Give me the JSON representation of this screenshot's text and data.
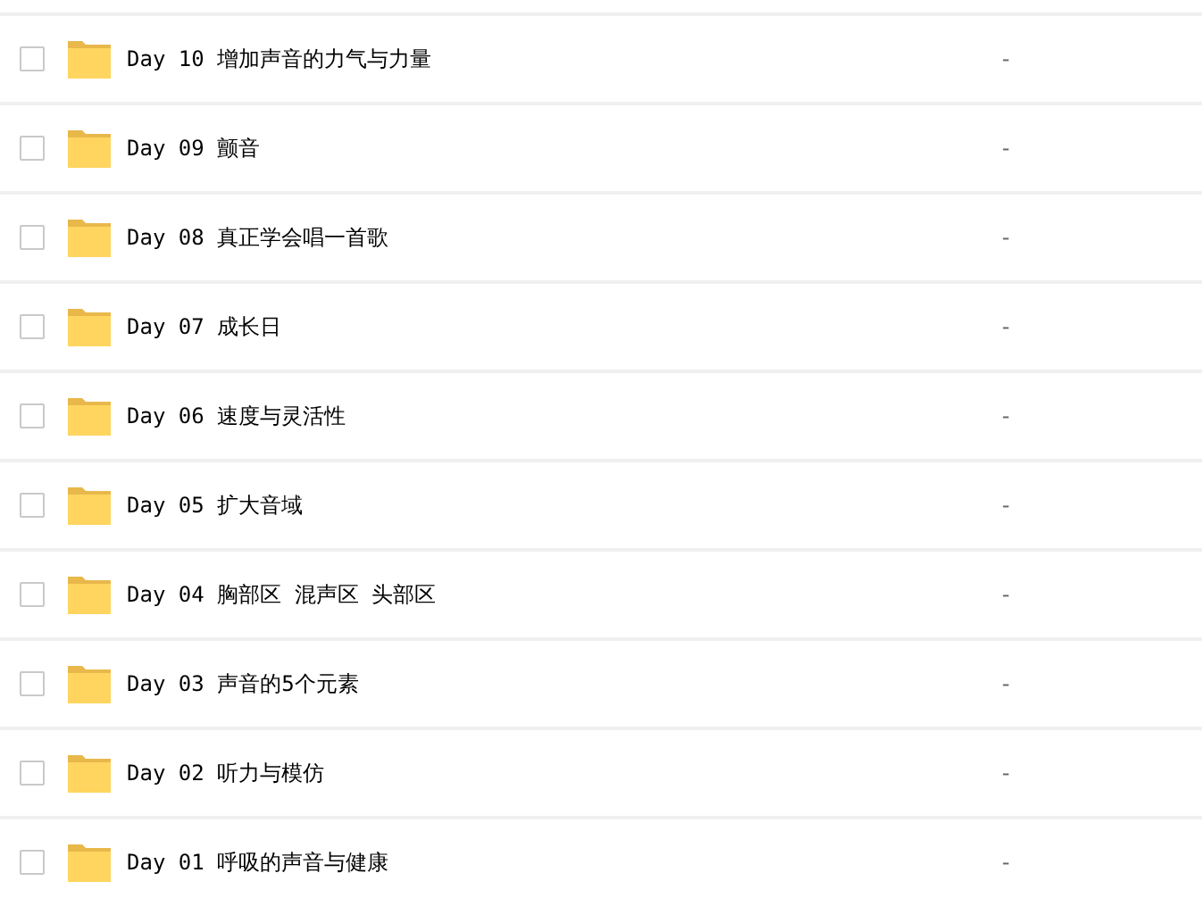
{
  "files": [
    {
      "name": "Day 10 增加声音的力气与力量",
      "size": "-",
      "checked": false
    },
    {
      "name": "Day 09 颤音",
      "size": "-",
      "checked": false
    },
    {
      "name": "Day 08 真正学会唱一首歌",
      "size": "-",
      "checked": false
    },
    {
      "name": "Day 07 成长日",
      "size": "-",
      "checked": false
    },
    {
      "name": "Day 06 速度与灵活性",
      "size": "-",
      "checked": false
    },
    {
      "name": "Day 05 扩大音域",
      "size": "-",
      "checked": false
    },
    {
      "name": "Day 04 胸部区 混声区 头部区",
      "size": "-",
      "checked": false
    },
    {
      "name": "Day 03 声音的5个元素",
      "size": "-",
      "checked": false
    },
    {
      "name": "Day 02 听力与模仿",
      "size": "-",
      "checked": false
    },
    {
      "name": "Day 01 呼吸的声音与健康",
      "size": "-",
      "checked": false
    }
  ]
}
